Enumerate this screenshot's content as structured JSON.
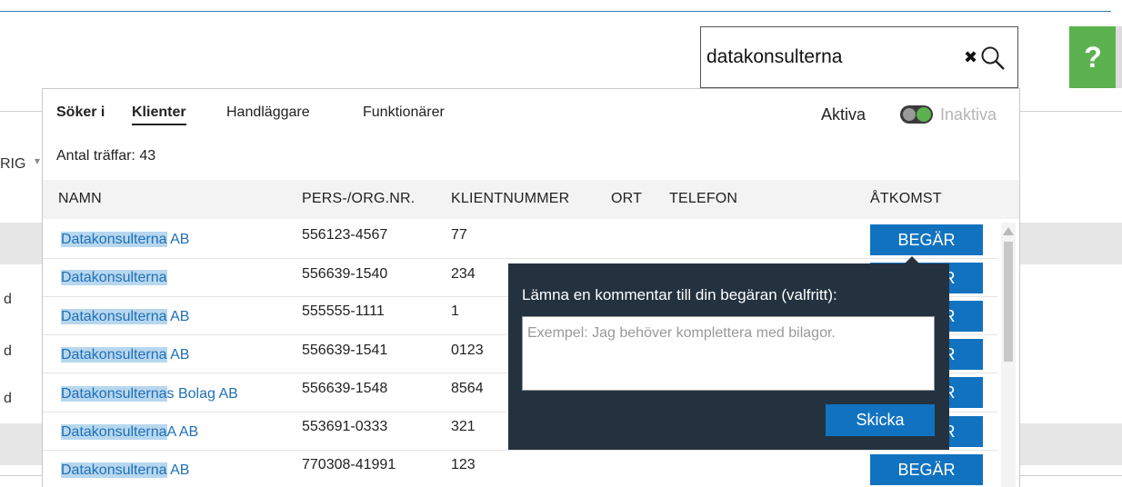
{
  "search": {
    "value": "datakonsulterna"
  },
  "help": {
    "label": "?"
  },
  "background": {
    "col_fragment": "RIG",
    "row_glyphs": [
      "d",
      "d",
      "d"
    ]
  },
  "panel": {
    "searching_in_label": "Söker i",
    "tabs": [
      {
        "label": "Klienter",
        "active": true
      },
      {
        "label": "Handläggare",
        "active": false
      },
      {
        "label": "Funktionärer",
        "active": false
      }
    ],
    "aktiva_label": "Aktiva",
    "inaktiva_label": "Inaktiva",
    "hits_label": "Antal träffar:",
    "hits_count": "43",
    "columns": {
      "name": "NAMN",
      "orgnr": "PERS-/ORG.NR.",
      "clientnr": "KLIENTNUMMER",
      "city": "ORT",
      "phone": "TELEFON",
      "access": "ÅTKOMST"
    },
    "rows": [
      {
        "name_match": "Datakonsulterna",
        "name_rest": " AB",
        "orgnr": "556123-4567",
        "clientnr": "77",
        "access": "BEGÄR"
      },
      {
        "name_match": "Datakonsulterna",
        "name_rest": "",
        "orgnr": "556639-1540",
        "clientnr": "234",
        "access": "BEGÄR"
      },
      {
        "name_match": "Datakonsulterna",
        "name_rest": " AB",
        "orgnr": "555555-1111",
        "clientnr": "1",
        "access": "BEGÄR"
      },
      {
        "name_match": "Datakonsulterna",
        "name_rest": " AB",
        "orgnr": "556639-1541",
        "clientnr": "0123",
        "access": "BEGÄR"
      },
      {
        "name_match": "Datakonsulterna",
        "name_rest": "s Bolag AB",
        "orgnr": "556639-1548",
        "clientnr": "8564",
        "access": "BEGÄR"
      },
      {
        "name_match": "Datakonsulterna",
        "name_rest": "A AB",
        "orgnr": "553691-0333",
        "clientnr": "321",
        "access": "BEGÄR"
      },
      {
        "name_match": "Datakonsulterna",
        "name_rest": " AB",
        "orgnr": "770308-41991",
        "clientnr": "123",
        "access": "BEGÄR"
      }
    ]
  },
  "popup": {
    "title": "Lämna en kommentar till din begäran (valfritt):",
    "placeholder": "Exempel: Jag behöver komplettera med bilagor.",
    "submit_label": "Skicka"
  },
  "colors": {
    "accent": "#1173c0",
    "help_green": "#5bb24f",
    "highlight": "#b7d7ee",
    "popup_bg": "#243240"
  }
}
